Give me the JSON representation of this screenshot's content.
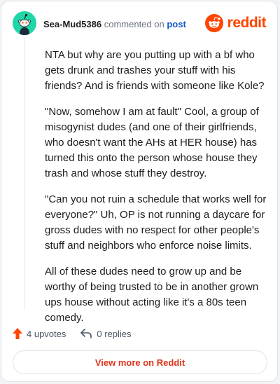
{
  "header": {
    "username": "Sea-Mud5386",
    "commented_on": "commented on",
    "post_link": "post",
    "brand": "reddit"
  },
  "comment": {
    "paragraphs": [
      "NTA but why are you putting up with a bf who gets drunk and trashes your stuff with his friends? And is friends with someone like Kole?",
      "\"Now, somehow I am at fault\" Cool, a group of misogynist dudes (and one of their girlfriends, who doesn't want the AHs at HER house) has turned this onto the person whose house they trash and whose stuff they destroy.",
      "\"Can you not ruin a schedule that works well for everyone?\" Uh, OP is not running a daycare for gross dudes with no respect for other people's stuff and neighbors who enforce noise limits.",
      "All of these dudes need to grow up and be worthy of being trusted to be in another grown ups house without acting like it's a 80s teen comedy."
    ]
  },
  "actions": {
    "upvotes": "4 upvotes",
    "replies": "0 replies"
  },
  "footer": {
    "view_more": "View more on Reddit"
  },
  "icons": {
    "avatar": "snoo-avatar-icon",
    "brand": "reddit-logo-icon",
    "upvote": "upvote-arrow-icon",
    "reply": "reply-arrow-icon"
  },
  "colors": {
    "brand": "#ff4500",
    "avatar_bg": "#21d6a6",
    "link": "#0f57c8",
    "view_more": "#e0361c"
  }
}
